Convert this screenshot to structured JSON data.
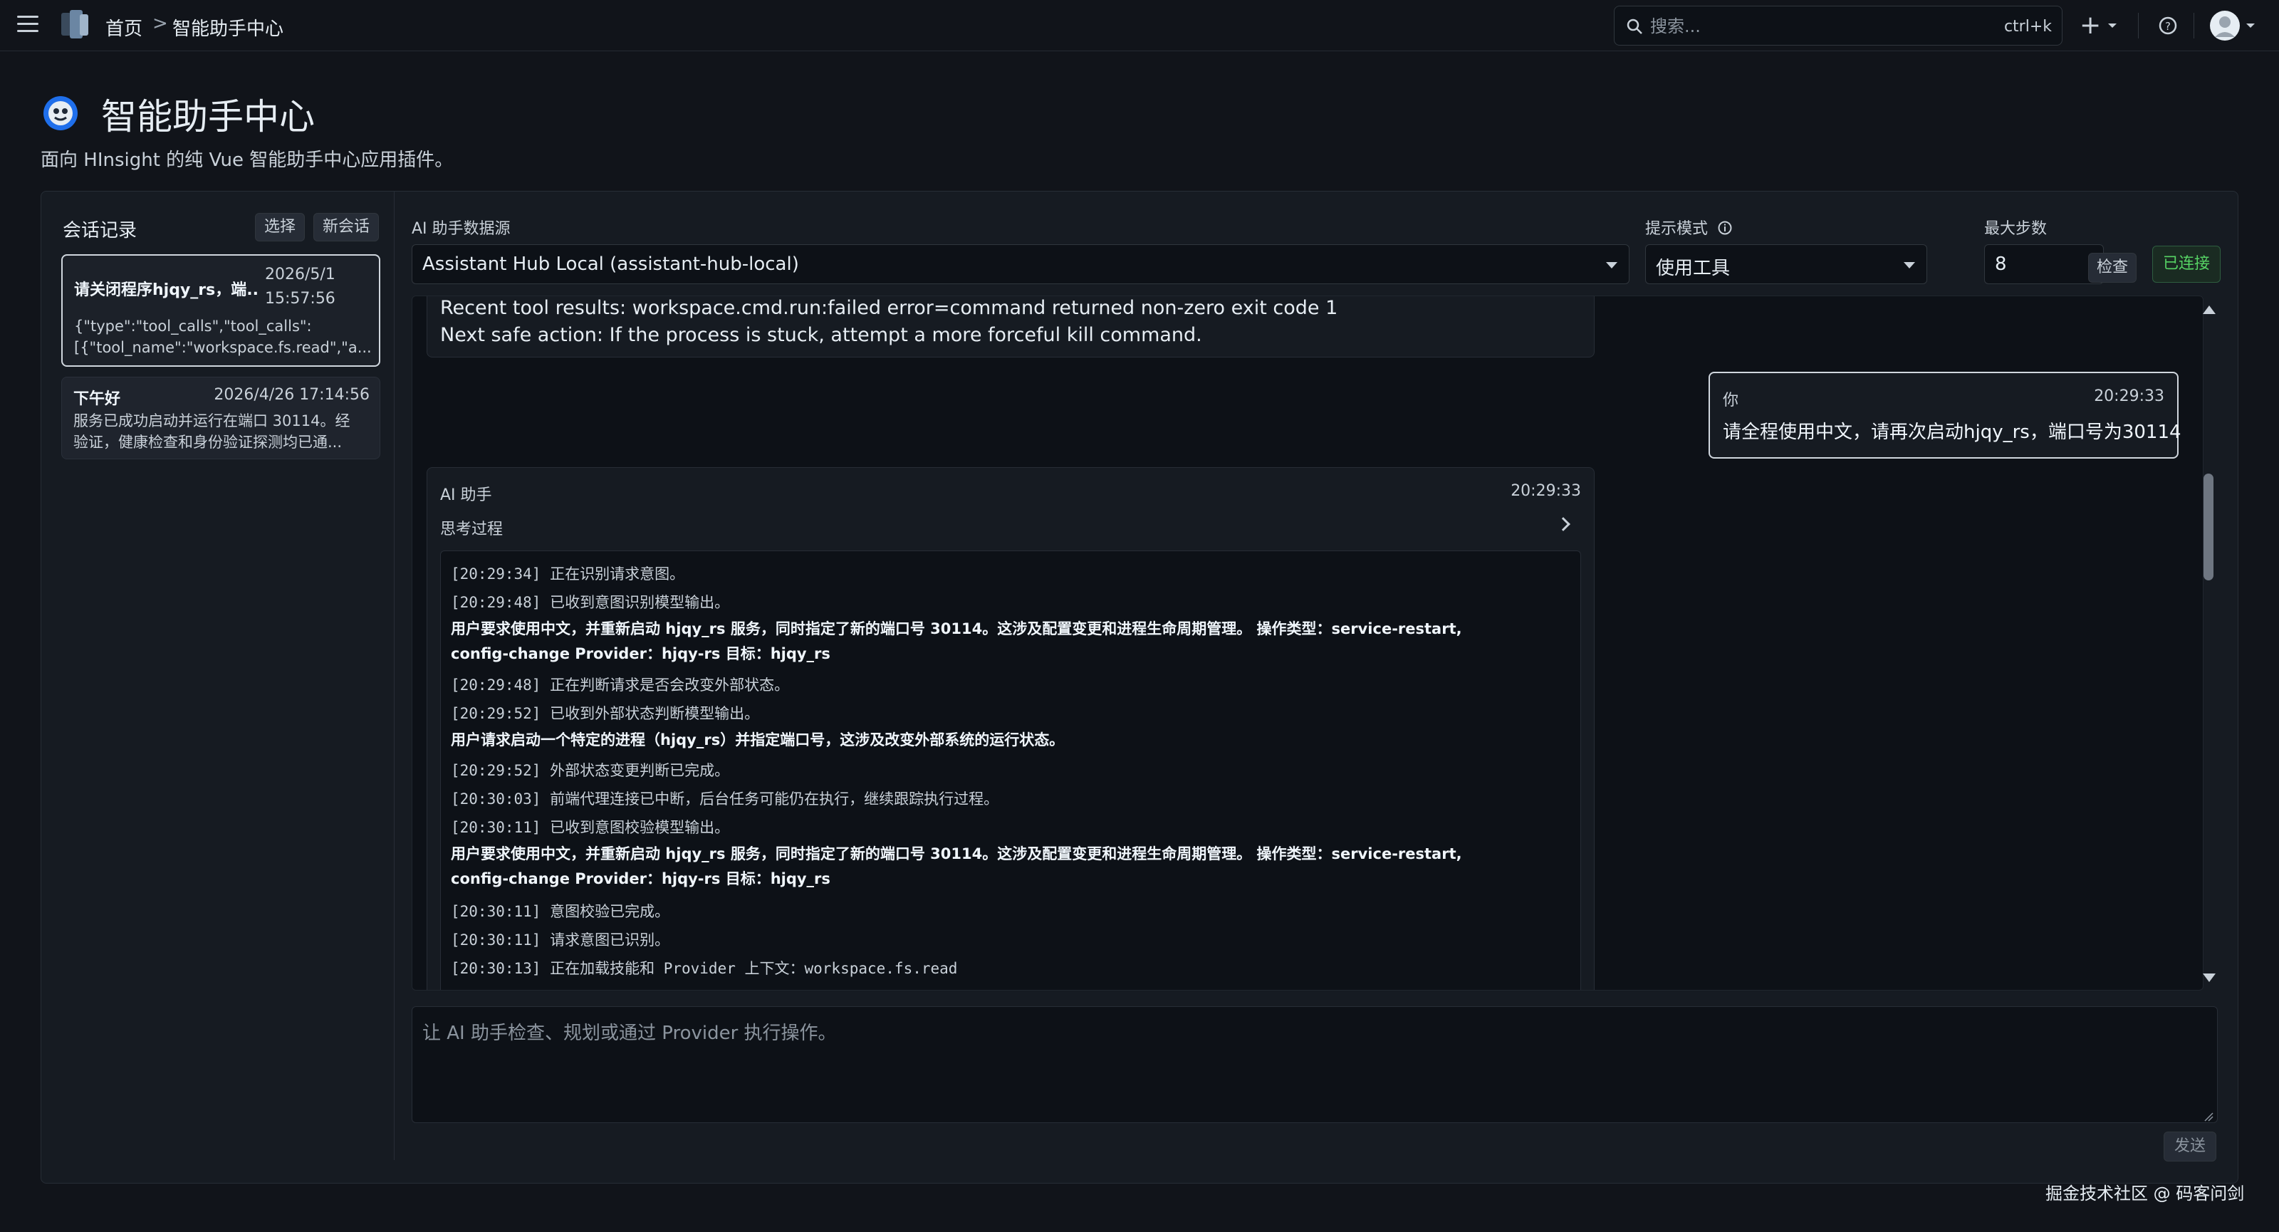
{
  "nav": {
    "home": "首页",
    "separator": ">",
    "current": "智能助手中心",
    "search_placeholder": "搜索...",
    "search_shortcut": "ctrl+k",
    "add_label": "+",
    "icons": [
      "menu-icon",
      "logo-icon",
      "search-icon",
      "plus-icon",
      "help-icon",
      "avatar-icon"
    ]
  },
  "header": {
    "title": "智能助手中心",
    "subtitle": "面向 HInsight 的纯 Vue 智能助手中心应用插件。"
  },
  "sidebar": {
    "title": "会话记录",
    "select_label": "选择",
    "new_label": "新会话",
    "conversations": [
      {
        "title": "请关闭程序hjqy_rs，端...",
        "date": "2026/5/1",
        "time": "15:57:56",
        "preview_1": "{\"type\":\"tool_calls\",\"tool_calls\":",
        "preview_2": "[{\"tool_name\":\"workspace.fs.read\",\"a...",
        "active": true
      },
      {
        "title": "下午好",
        "datetime": "2026/4/26 17:14:56",
        "preview_1": "服务已成功启动并运行在端口 30114。经",
        "preview_2": "验证，健康检查和身份验证探测均已通...",
        "active": false
      }
    ]
  },
  "toolbar": {
    "datasource_label": "AI 助手数据源",
    "datasource_value": "Assistant Hub Local (assistant-hub-local)",
    "mode_label": "提示模式",
    "mode_value": "使用工具",
    "steps_label": "最大步数",
    "steps_value": "8",
    "check_label": "检查",
    "status_label": "已连接",
    "status_color": "#56d364"
  },
  "chat": {
    "prev_line_1": "Recent tool results: workspace.cmd.run:failed error=command returned non-zero exit code 1",
    "prev_line_2": "Next safe action: If the process is stuck, attempt a more forceful kill command.",
    "user": {
      "who": "你",
      "time": "20:29:33",
      "text": "请全程使用中文，请再次启动hjqy_rs，端口号为30114"
    },
    "ai": {
      "who": "AI 助手",
      "time": "20:29:33",
      "thinking_label": "思考过程",
      "log": [
        {
          "kind": "ts",
          "text": "[20:29:34] 正在识别请求意图。"
        },
        {
          "kind": "ts",
          "text": "[20:29:48] 已收到意图识别模型输出。"
        },
        {
          "kind": "bold",
          "text": "用户要求使用中文，并重新启动 hjqy_rs 服务，同时指定了新的端口号 30114。这涉及配置变更和进程生命周期管理。 操作类型：service-restart, config-change Provider：hjqy-rs 目标：hjqy_rs"
        },
        {
          "kind": "ts",
          "text": "[20:29:48] 正在判断请求是否会改变外部状态。"
        },
        {
          "kind": "ts",
          "text": "[20:29:52] 已收到外部状态判断模型输出。"
        },
        {
          "kind": "bold",
          "text": "用户请求启动一个特定的进程（hjqy_rs）并指定端口号，这涉及改变外部系统的运行状态。"
        },
        {
          "kind": "ts",
          "text": "[20:29:52] 外部状态变更判断已完成。"
        },
        {
          "kind": "ts",
          "text": "[20:30:03] 前端代理连接已中断，后台任务可能仍在执行，继续跟踪执行过程。"
        },
        {
          "kind": "ts",
          "text": "[20:30:11] 已收到意图校验模型输出。"
        },
        {
          "kind": "bold",
          "text": "用户要求使用中文，并重新启动 hjqy_rs 服务，同时指定了新的端口号 30114。这涉及配置变更和进程生命周期管理。 操作类型：service-restart, config-change Provider：hjqy-rs 目标：hjqy_rs"
        },
        {
          "kind": "ts",
          "text": "[20:30:11] 意图校验已完成。"
        },
        {
          "kind": "ts",
          "text": "[20:30:11] 请求意图已识别。"
        },
        {
          "kind": "ts",
          "text": "[20:30:13] 正在加载技能和 Provider 上下文：workspace.fs.read"
        }
      ]
    }
  },
  "composer": {
    "placeholder": "让 AI 助手检查、规划或通过 Provider 执行操作。",
    "send_label": "发送"
  },
  "watermark": "掘金技术社区 @ 码客问剑"
}
